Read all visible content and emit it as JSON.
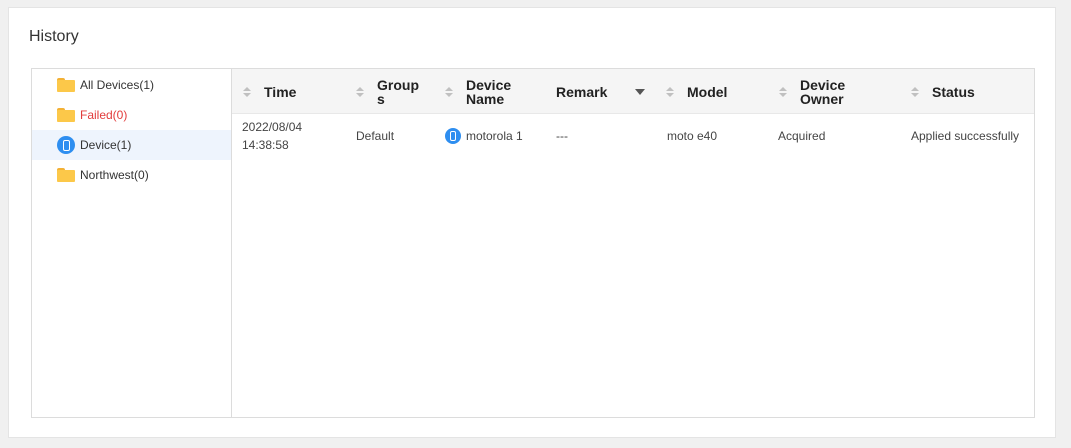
{
  "panel": {
    "title": "History"
  },
  "sidebar": {
    "items": [
      {
        "label": "All Devices(1)",
        "icon": "folder-icon"
      },
      {
        "label": "Failed(0)",
        "icon": "folder-icon"
      },
      {
        "label": "Device(1)",
        "icon": "device-icon",
        "selected": true
      },
      {
        "label": "Northwest(0)",
        "icon": "folder-icon"
      }
    ]
  },
  "table": {
    "columns": {
      "time": "Time",
      "groups_1": "Group",
      "groups_2": "s",
      "device_name_1": "Device",
      "device_name_2": "Name",
      "remark": "Remark",
      "model": "Model",
      "device_owner_1": "Device",
      "device_owner_2": "Owner",
      "status": "Status"
    },
    "rows": [
      {
        "time_date": "2022/08/04",
        "time_clock": "14:38:58",
        "groups": "Default",
        "device_name": "motorola 1",
        "remark": "---",
        "model": "moto e40",
        "device_owner": "Acquired",
        "status": "Applied successfully"
      }
    ]
  },
  "colors": {
    "accent": "#2e8ef0",
    "failed": "#e23b3b",
    "folder": "#fcc849",
    "selected_bg": "#eef4fd"
  }
}
